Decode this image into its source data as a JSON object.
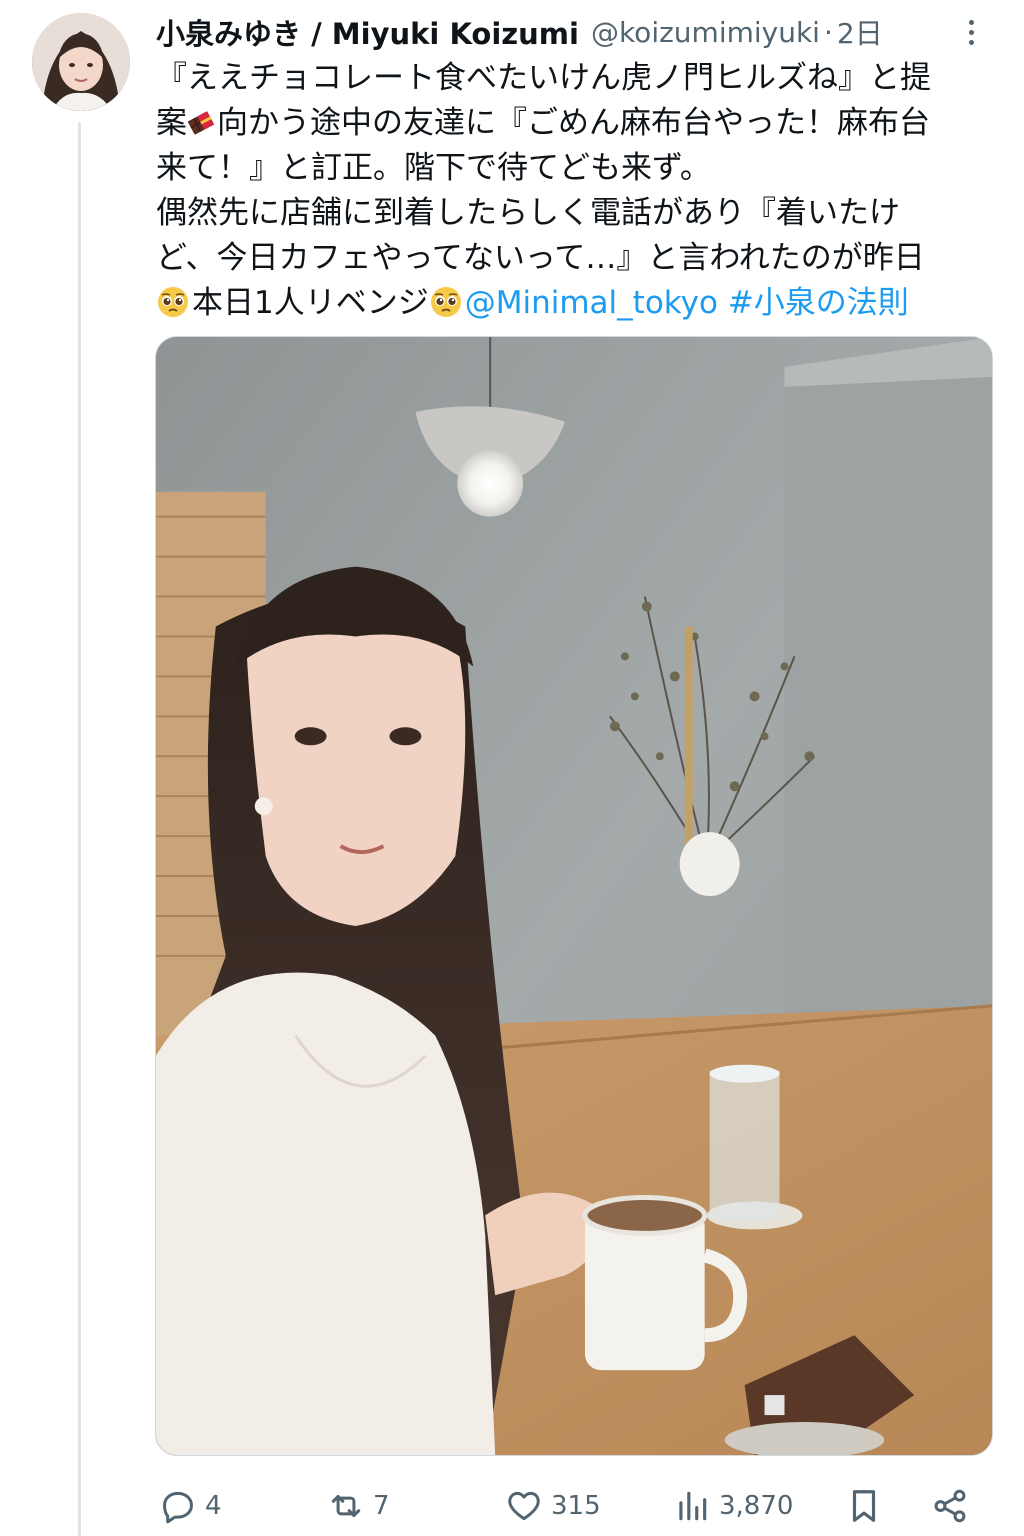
{
  "user": {
    "display_name": "小泉みゆき / Miyuki Koizumi",
    "handle": "@koizumimiyuki",
    "separator": "·",
    "time": "2日"
  },
  "tweet": {
    "line1": "『ええチョコレート食べたいけん虎ノ門ヒルズね』と提",
    "line2a": "案",
    "line2b": "向かう途中の友達に『ごめん麻布台やった！麻布台",
    "line3": "来て！』と訂正。階下で待てども来ず。",
    "line4": "偶然先に店舗に到着したらしく電話があり『着いたけ",
    "line5": "ど、今日カフェやってないって…』と言われたのが昨日",
    "line6a": "本日1人リベンジ",
    "mention": "@Minimal_tokyo",
    "hashtag": "#小泉の法則"
  },
  "icons": {
    "more": "more-options-icon",
    "reply": "reply-icon",
    "retweet": "retweet-icon",
    "like": "like-icon",
    "views": "views-icon",
    "bookmark": "bookmark-icon",
    "share": "share-icon",
    "chocolate": "chocolate-emoji",
    "pleading": "pleading-face-emoji"
  },
  "stats": {
    "replies": "4",
    "retweets": "7",
    "likes": "315",
    "views": "3,870"
  },
  "colors": {
    "link": "#1d9bf0",
    "secondary_text": "#536471",
    "primary_text": "#0f1419"
  }
}
